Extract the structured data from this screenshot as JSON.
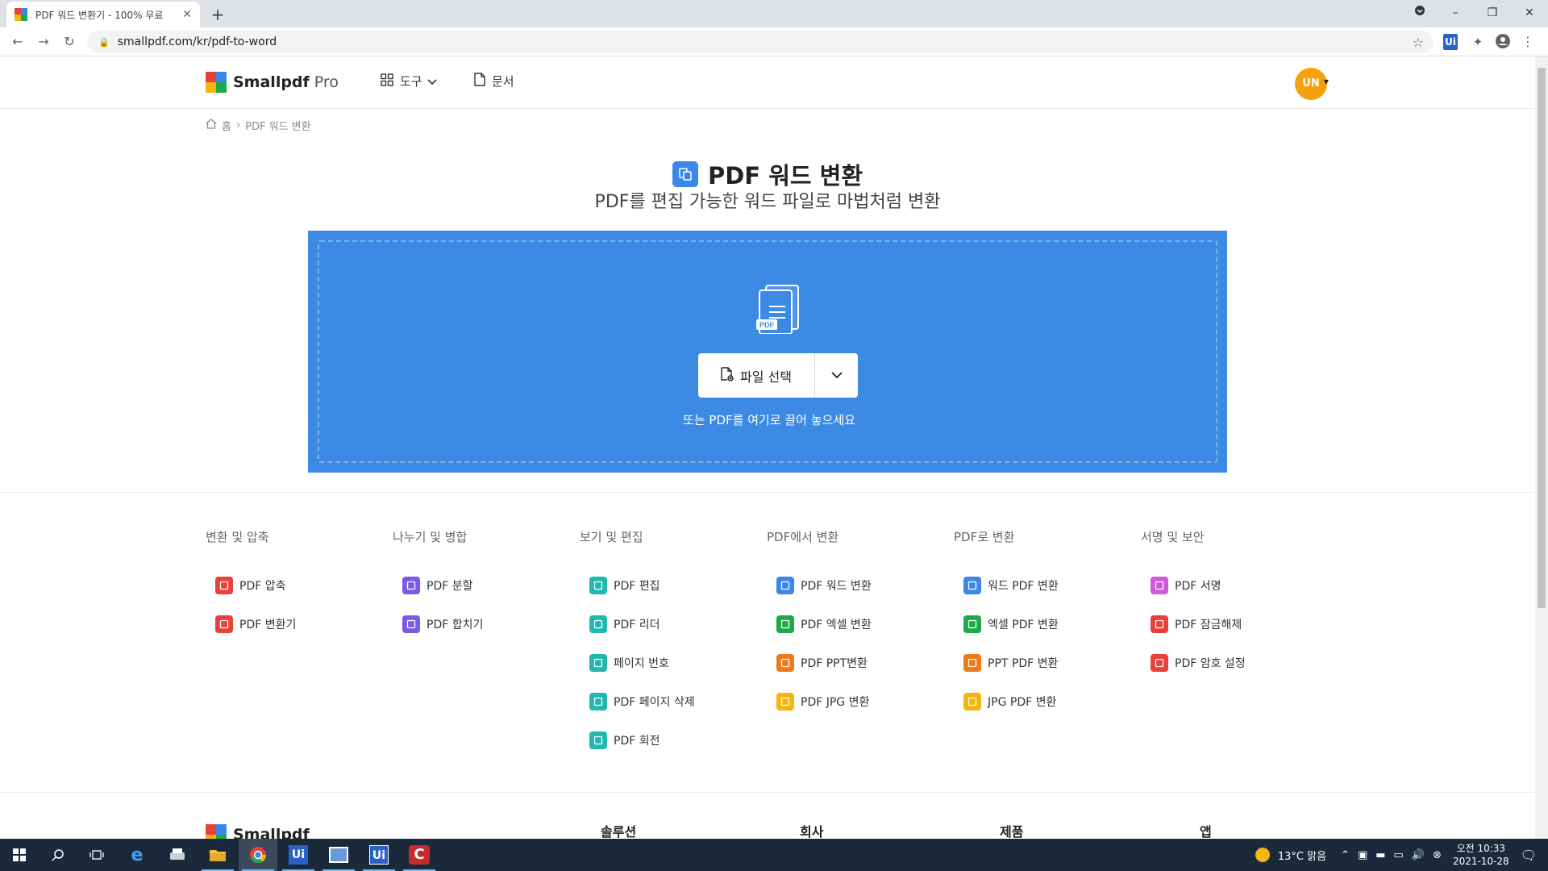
{
  "browser": {
    "tab_title": "PDF 워드 변환기 - 100% 무료",
    "url": "smallpdf.com/kr/pdf-to-word",
    "new_tab": "+",
    "tab_close": "✕"
  },
  "header": {
    "brand": "Smallpdf",
    "pro": "Pro",
    "nav_tools": "도구",
    "nav_docs": "문서",
    "avatar": "UN"
  },
  "breadcrumb": {
    "home": "홈",
    "sep": "›",
    "current": "PDF 워드 변환"
  },
  "hero": {
    "title": "PDF 워드 변환",
    "subtitle": "PDF를 편집 가능한 워드 파일로 마법처럼 변환"
  },
  "dropzone": {
    "doc_badge": "PDF",
    "choose_label": "파일 선택",
    "hint": "또는 PDF를 여기로 끌어 놓으세요"
  },
  "tool_columns": [
    {
      "heading": "변환 및 압축",
      "items": [
        {
          "label": "PDF 압축",
          "color": "#e8413b"
        },
        {
          "label": "PDF 변환기",
          "color": "#e8413b"
        }
      ]
    },
    {
      "heading": "나누기 및 병합",
      "items": [
        {
          "label": "PDF 분할",
          "color": "#7b5be6"
        },
        {
          "label": "PDF 합치기",
          "color": "#7b5be6"
        }
      ]
    },
    {
      "heading": "보기 및 편집",
      "items": [
        {
          "label": "PDF 편집",
          "color": "#22b8b0"
        },
        {
          "label": "PDF 리더",
          "color": "#22b8b0"
        },
        {
          "label": "페이지 번호",
          "color": "#22b8b0"
        },
        {
          "label": "PDF 페이지 삭제",
          "color": "#22b8b0"
        },
        {
          "label": "PDF 회전",
          "color": "#22b8b0"
        }
      ]
    },
    {
      "heading": "PDF에서 변환",
      "items": [
        {
          "label": "PDF 워드 변환",
          "color": "#3c88e8"
        },
        {
          "label": "PDF 엑셀 변환",
          "color": "#1faa4a"
        },
        {
          "label": "PDF PPT변환",
          "color": "#f07a1a"
        },
        {
          "label": "PDF JPG 변환",
          "color": "#f5b50f"
        }
      ]
    },
    {
      "heading": "PDF로 변환",
      "items": [
        {
          "label": "워드 PDF 변환",
          "color": "#3c88e8"
        },
        {
          "label": "엑셀 PDF 변환",
          "color": "#1faa4a"
        },
        {
          "label": "PPT PDF 변환",
          "color": "#f07a1a"
        },
        {
          "label": "JPG PDF 변환",
          "color": "#f5b50f"
        }
      ]
    },
    {
      "heading": "서명 및 보안",
      "items": [
        {
          "label": "PDF 서명",
          "color": "#d05ad8"
        },
        {
          "label": "PDF 잠금해제",
          "color": "#e8413b"
        },
        {
          "label": "PDF 암호 설정",
          "color": "#e8413b"
        }
      ]
    }
  ],
  "footer": {
    "brand": "Smallpdf",
    "col1": "솔루션",
    "col2": "회사",
    "col3": "제품",
    "col4": "앱"
  },
  "taskbar": {
    "weather": "13°C 맑음",
    "time": "오전 10:33",
    "date": "2021-10-28"
  },
  "colors": {
    "accent_blue": "#3d8ae5",
    "avatar_orange": "#f5a10f",
    "taskbar": "#1b2a3a"
  }
}
